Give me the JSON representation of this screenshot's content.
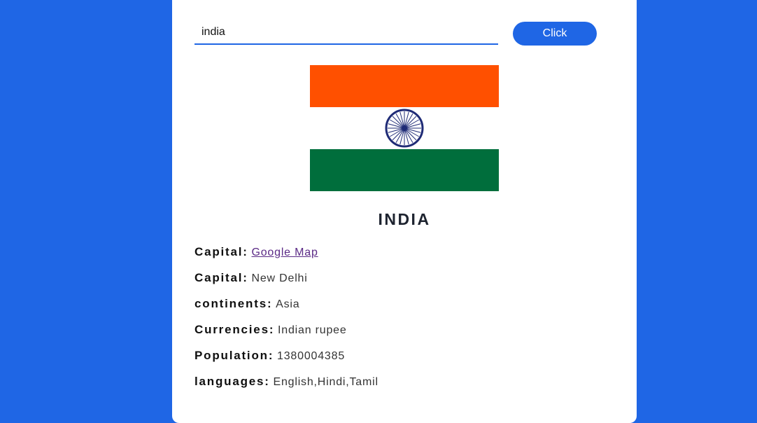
{
  "search": {
    "value": "india",
    "placeholder": ""
  },
  "button": {
    "label": "Click"
  },
  "flag": {
    "name": "india-flag",
    "colors": {
      "saffron": "#ff5000",
      "white": "#ffffff",
      "green": "#006e3c",
      "chakra": "#1f2b76"
    }
  },
  "country": {
    "name": "INDIA",
    "rows": [
      {
        "label": "Capital:",
        "value": "Google Map",
        "is_link": true
      },
      {
        "label": "Capital:",
        "value": "New Delhi",
        "is_link": false
      },
      {
        "label": "continents:",
        "value": "Asia",
        "is_link": false
      },
      {
        "label": "Currencies:",
        "value": "Indian rupee",
        "is_link": false
      },
      {
        "label": "Population:",
        "value": "1380004385",
        "is_link": false
      },
      {
        "label": "languages:",
        "value": "English,Hindi,Tamil",
        "is_link": false
      }
    ]
  },
  "theme": {
    "background": "#1f66e5",
    "accent": "#1f66e5",
    "card": "#ffffff"
  }
}
